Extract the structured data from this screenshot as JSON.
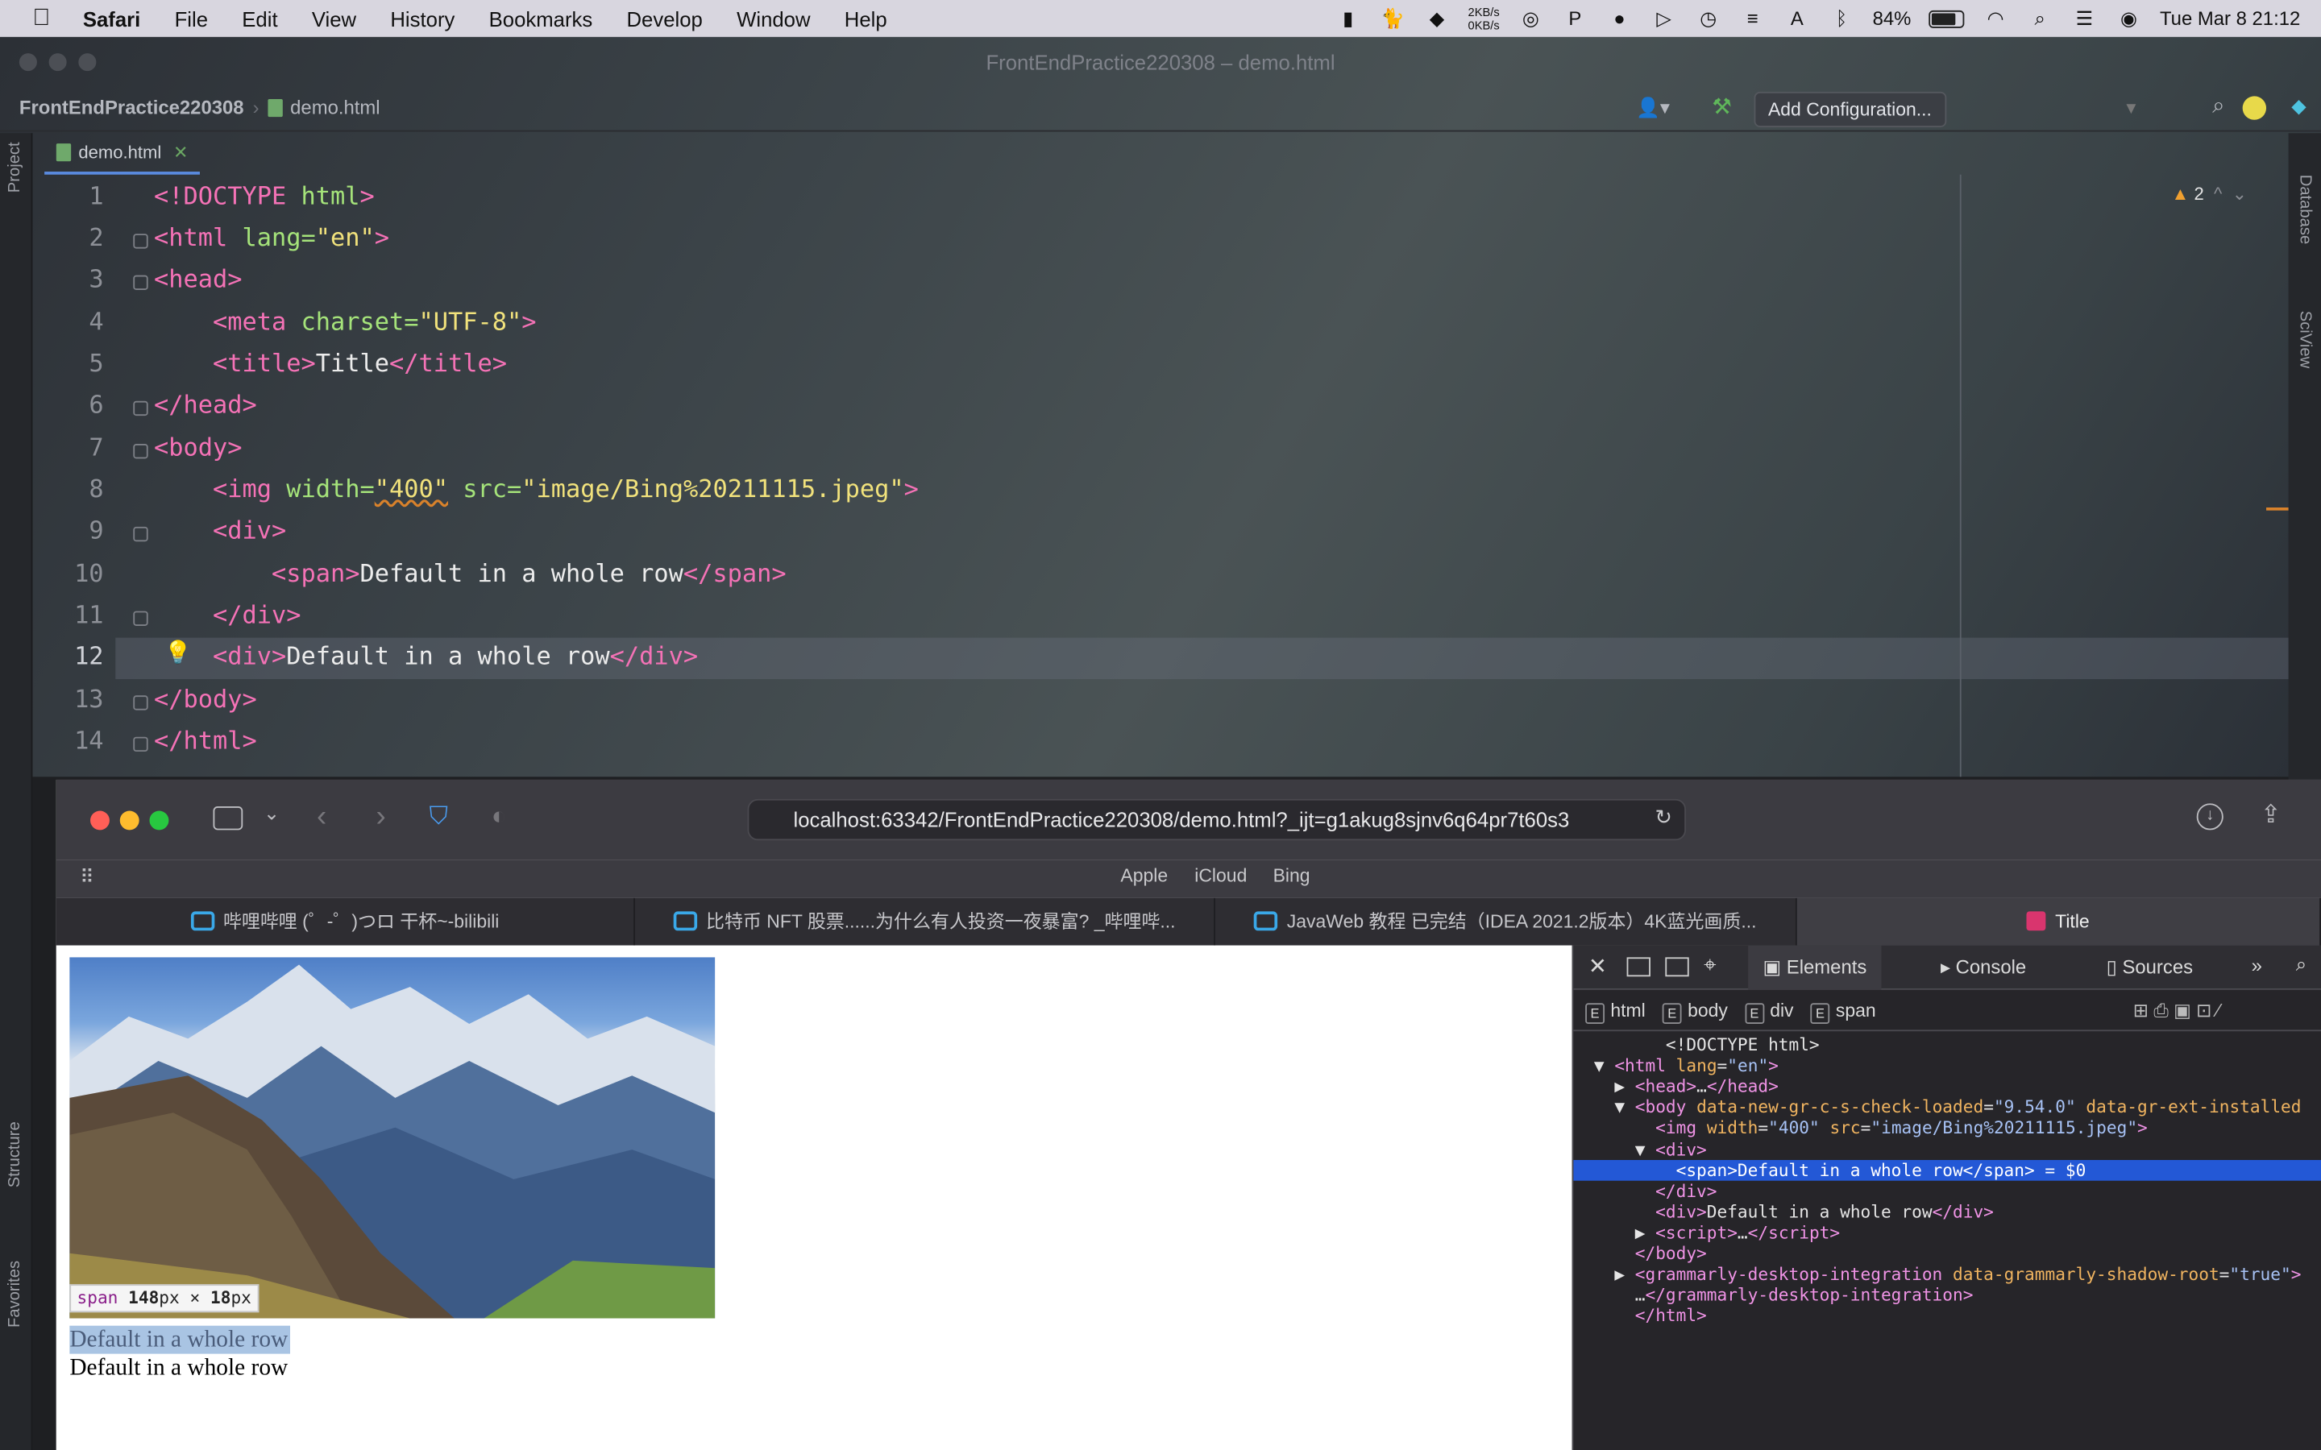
{
  "menubar": {
    "apple": "",
    "app": "Safari",
    "items": [
      "File",
      "Edit",
      "View",
      "History",
      "Bookmarks",
      "Develop",
      "Window",
      "Help"
    ],
    "net_up": "2KB/s",
    "net_down": "0KB/s",
    "battery": "84%",
    "datetime": "Tue Mar 8  21:12"
  },
  "ide": {
    "title": "FrontEndPractice220308 – demo.html",
    "project": "FrontEndPractice220308",
    "file": "demo.html",
    "add_config": "Add Configuration...",
    "tab": "demo.html",
    "warnings": "2",
    "left_tools": [
      "Project",
      "Structure",
      "Favorites"
    ],
    "right_tools": [
      "Database",
      "SciView"
    ]
  },
  "code": {
    "line_numbers": [
      "1",
      "2",
      "3",
      "4",
      "5",
      "6",
      "7",
      "8",
      "9",
      "10",
      "11",
      "12",
      "13",
      "14"
    ],
    "current_line": "12"
  },
  "safari": {
    "url": "localhost:63342/FrontEndPractice220308/demo.html?_ijt=g1akug8sjnv6q64pr7t60s3",
    "favorites": [
      "Apple",
      "iCloud",
      "Bing"
    ],
    "tabs": [
      "哔哩哔哩 (゜-゜)つロ 干杯~-bilibili",
      "比特币 NFT 股票......为什么有人投资一夜暴富? _哔哩哔...",
      "JavaWeb 教程 已完结（IDEA 2021.2版本）4K蓝光画质...",
      "Title"
    ]
  },
  "page": {
    "badge_tag": "span",
    "badge_w": "148",
    "badge_h": "18",
    "badge_unit": "px",
    "badge_x": "×",
    "text1": "Default in a whole row",
    "text2": "Default in a whole row"
  },
  "devtools": {
    "tabs": [
      "Elements",
      "Console",
      "Sources"
    ],
    "crumbs": [
      "html",
      "body",
      "div",
      "span"
    ]
  },
  "colors": {
    "tag": "#f472b6",
    "attr": "#a5e37a",
    "value": "#f1e27c",
    "selection": "#2358d6"
  }
}
